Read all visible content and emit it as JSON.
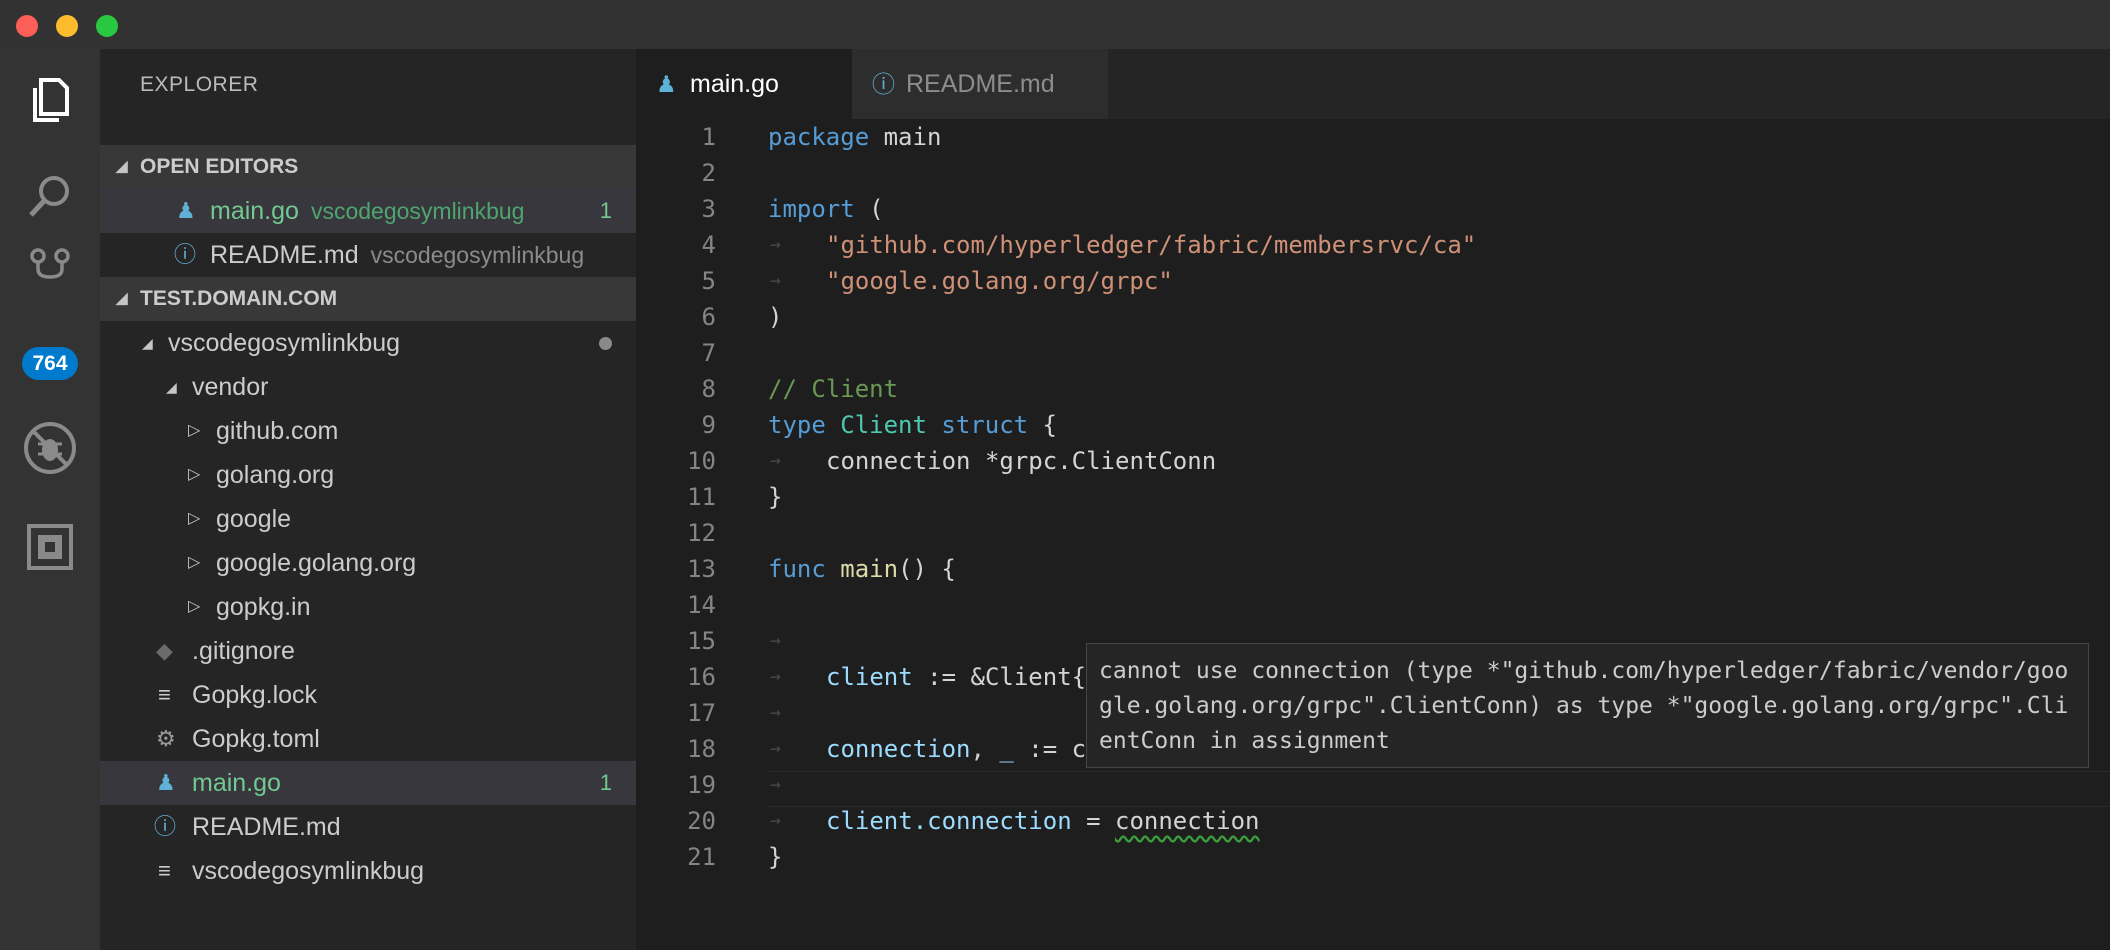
{
  "window": {
    "close_label": "",
    "minimize_label": "",
    "maximize_label": ""
  },
  "activity_bar": {
    "icons": [
      "explorer-icon",
      "search-icon",
      "source-control-icon",
      "debug-icon",
      "extensions-icon"
    ],
    "scm_badge": "764"
  },
  "sidebar": {
    "title": "EXPLORER",
    "open_editors": {
      "header": "OPEN EDITORS",
      "items": [
        {
          "name": "main.go",
          "desc": "vscodegosymlinkbug",
          "count": "1"
        },
        {
          "name": "README.md",
          "desc": "vscodegosymlinkbug"
        }
      ]
    },
    "workspace": {
      "header": "TEST.DOMAIN.COM",
      "root": "vscodegosymlinkbug",
      "vendor": "vendor",
      "vendor_children": [
        "github.com",
        "golang.org",
        "google",
        "google.golang.org",
        "gopkg.in"
      ],
      "files": [
        {
          "name": ".gitignore",
          "icon": "git-icon"
        },
        {
          "name": "Gopkg.lock",
          "icon": "lines-icon"
        },
        {
          "name": "Gopkg.toml",
          "icon": "gear-icon"
        },
        {
          "name": "main.go",
          "icon": "gopher-icon",
          "count": "1"
        },
        {
          "name": "README.md",
          "icon": "info-icon"
        },
        {
          "name": "vscodegosymlinkbug",
          "icon": "lines-icon"
        }
      ]
    }
  },
  "tabs": [
    {
      "label": "main.go",
      "active": true
    },
    {
      "label": "README.md",
      "active": false
    }
  ],
  "editor": {
    "line_numbers": [
      "1",
      "2",
      "3",
      "4",
      "5",
      "6",
      "7",
      "8",
      "9",
      "10",
      "11",
      "12",
      "13",
      "14",
      "15",
      "16",
      "17",
      "18",
      "19",
      "20",
      "21"
    ],
    "code": {
      "l1_kw": "package",
      "l1_rest": " main",
      "l3_kw": "import",
      "l3_rest": " (",
      "l4_str": "\"github.com/hyperledger/fabric/membersrvc/ca\"",
      "l5_str": "\"google.golang.org/grpc\"",
      "l6": ")",
      "l8_cm": "// Client",
      "l9_kw1": "type",
      "l9_ty": "Client",
      "l9_kw2": "struct",
      "l9_rest": " {",
      "l10_var": "connection",
      "l10_rest": " *grpc.ClientConn",
      "l11": "}",
      "l13_kw": "func",
      "l13_fn": "main",
      "l13_rest": "() {",
      "l15_var": "client",
      "l15_rest": " := &Client{}",
      "l17_var1": "connection",
      "l17_mid": ", ",
      "l17_var2": "_",
      "l17_rest": " := c",
      "l19_var": "client.connection",
      "l19_eq": " = ",
      "l19_err": "connection",
      "l20": "}"
    },
    "hover": "cannot use connection (type *\"github.com/hyperledger/fabric/vendor/google.golang.org/grpc\".ClientConn) as type *\"google.golang.org/grpc\".ClientConn in assignment"
  }
}
